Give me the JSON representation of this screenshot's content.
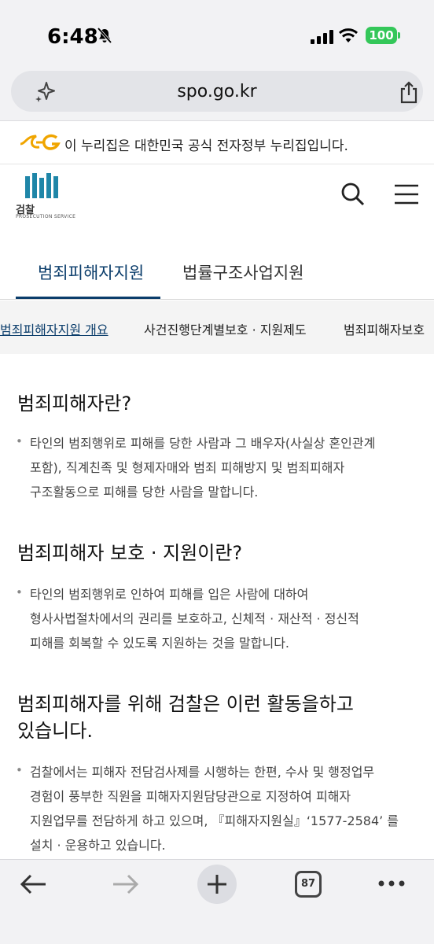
{
  "status_bar": {
    "time": "6:48",
    "battery": "100"
  },
  "browser": {
    "url": "spo.go.kr",
    "tab_count": "87"
  },
  "gov_banner": {
    "text": "이 누리집은 대한민국 공식 전자정부 누리집입니다."
  },
  "site": {
    "logo_title": "검찰",
    "logo_subtitle": "PROSECUTION SERVICE"
  },
  "tabs": [
    "범죄피해자지원",
    "법률구조사업지원"
  ],
  "subtabs": [
    "범죄피해자지원 개요",
    "사건진행단계별보호 · 지원제도",
    "범죄피해자보호"
  ],
  "sections": [
    {
      "title": "범죄피해자란?",
      "lines": [
        "타인의 범죄행위로 피해를 당한 사람과 그 배우자(사실상 혼인관계",
        "포함), 직계친족 및 형제자매와 범죄 피해방지 및 범죄피해자",
        "구조활동으로 피해를 당한 사람을 말합니다."
      ]
    },
    {
      "title": "범죄피해자 보호 · 지원이란?",
      "lines": [
        "타인의 범죄행위로 인하여 피해를 입은 사람에 대하여",
        "형사사법절차에서의 권리를 보호하고, 신체적 · 재산적 · 정신적",
        "피해를 회복할 수 있도록 지원하는 것을 말합니다."
      ]
    },
    {
      "title_lines": [
        "범죄피해자를 위해 검찰은 이런 활동을하고",
        "있습니다."
      ],
      "lines": [
        "검찰에서는 피해자 전담검사제를 시행하는 한편, 수사 및 행정업무",
        "경험이 풍부한 직원을 피해자지원담당관으로 지정하여 피해자",
        "지원업무를 전담하게 하고 있으며, 『피해자지원실』‘1577-2584’ 를",
        "설치 · 운용하고 있습니다."
      ]
    }
  ],
  "colors": {
    "accent": "#0b3d6b",
    "logo_blue": "#1f86a8",
    "eg_orange": "#f0a500",
    "battery_green": "#34c759"
  },
  "icons": [
    "bell-slash-icon",
    "signal-icon",
    "wifi-icon",
    "sparkle-icon",
    "share-icon",
    "search-icon",
    "hamburger-menu-icon",
    "back-arrow-icon",
    "forward-arrow-icon",
    "plus-icon",
    "more-icon"
  ]
}
